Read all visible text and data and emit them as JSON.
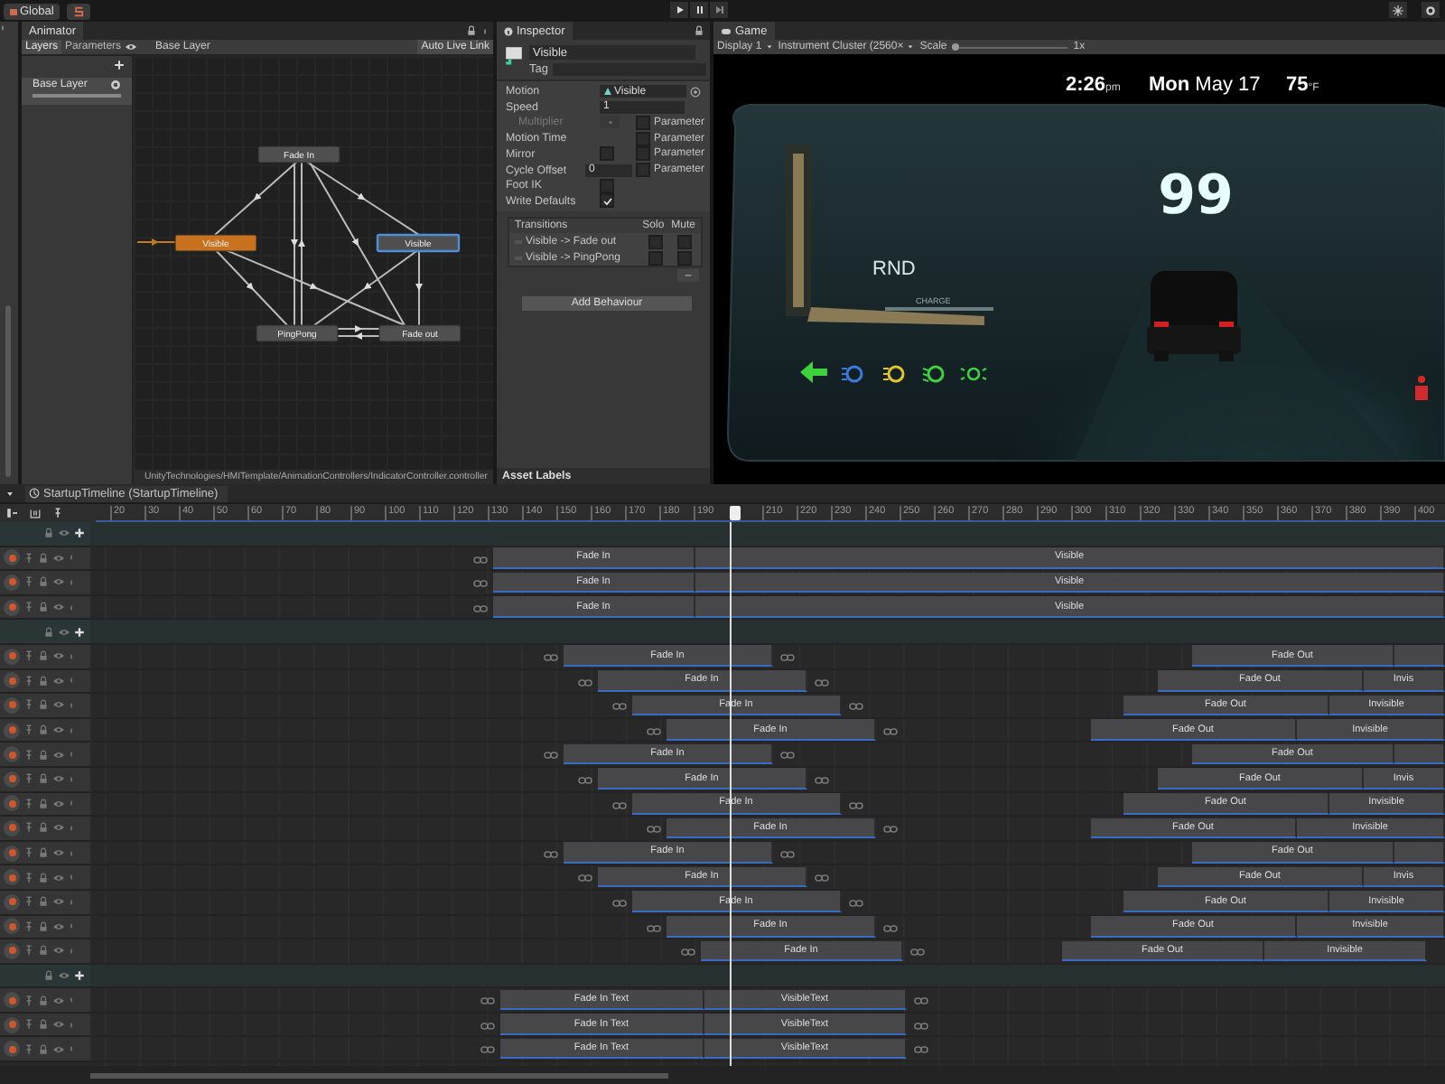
{
  "toolbar": {
    "global_button": "Global"
  },
  "animator": {
    "tab": "Animator",
    "tabs": [
      {
        "label": "Layers",
        "selected": true
      },
      {
        "label": "Parameters",
        "selected": false
      }
    ],
    "breadcrumb": "Base Layer",
    "live_link_button": "Auto Live Link",
    "layers": [
      {
        "name": "Base Layer"
      }
    ],
    "states": [
      {
        "name": "Fade In",
        "kind": "normal",
        "selected": false
      },
      {
        "name": "Visible",
        "kind": "default",
        "selected": false
      },
      {
        "name": "Visible",
        "kind": "normal",
        "selected": true
      },
      {
        "name": "PingPong",
        "kind": "normal",
        "selected": false
      },
      {
        "name": "Fade out",
        "kind": "normal",
        "selected": false
      }
    ],
    "path": "UnityTechnologies/HMITemplate/AnimationControllers/IndicatorController.controller"
  },
  "inspector": {
    "tab": "Inspector",
    "name": "Visible",
    "tag_label": "Tag",
    "properties": [
      {
        "label": "Motion",
        "kind": "object",
        "value": "Visible",
        "disabled": false
      },
      {
        "label": "Speed",
        "kind": "text",
        "value": "1",
        "disabled": false
      },
      {
        "label": "Multiplier",
        "kind": "dropdown",
        "disabled": true,
        "parameter": {
          "label": "Parameter",
          "checked": false
        }
      },
      {
        "label": "Motion Time",
        "kind": "none",
        "disabled": false,
        "parameter": {
          "label": "Parameter",
          "checked": false
        }
      },
      {
        "label": "Mirror",
        "kind": "toggle",
        "checked": false,
        "disabled": false,
        "parameter": {
          "label": "Parameter",
          "checked": false
        }
      },
      {
        "label": "Cycle Offset",
        "kind": "text",
        "value": "0",
        "disabled": false,
        "parameter": {
          "label": "Parameter",
          "checked": false
        }
      },
      {
        "label": "Foot IK",
        "kind": "toggle",
        "checked": false,
        "disabled": false
      },
      {
        "label": "Write Defaults",
        "kind": "toggle",
        "checked": true,
        "disabled": false
      }
    ],
    "transitions": {
      "header": "Transitions",
      "solo_label": "Solo",
      "mute_label": "Mute",
      "items": [
        {
          "name": "Visible -> Fade out",
          "solo": false,
          "mute": false
        },
        {
          "name": "Visible -> PingPong",
          "solo": false,
          "mute": false
        }
      ]
    },
    "remove_button": "–",
    "add_behaviour_button": "Add Behaviour",
    "asset_labels": "Asset Labels"
  },
  "game": {
    "tab": "Game",
    "display": "Display 1",
    "resolution": "Instrument Cluster (2560×",
    "scale_label": "Scale",
    "scale": {
      "level": 0
    },
    "scale_value": "1x",
    "cluster": {
      "time": "2:26",
      "time_suffix": "pm",
      "day": "Mon",
      "date": "May 17",
      "temperature": "75",
      "temperature_unit": "°F",
      "speed": "99",
      "gear": "RND",
      "charge_label": "CHARGE"
    }
  },
  "timeline": {
    "title": "StartupTimeline (StartupTimeline)",
    "ticks": [
      "20",
      "30",
      "40",
      "50",
      "60",
      "70",
      "80",
      "90",
      "100",
      "110",
      "120",
      "130",
      "140",
      "150",
      "160",
      "170",
      "180",
      "190",
      "210",
      "220",
      "230",
      "240",
      "250",
      "260",
      "270",
      "280",
      "290",
      "300",
      "310",
      "320",
      "330",
      "340",
      "350",
      "360",
      "370",
      "380",
      "390",
      "400"
    ],
    "groups": [
      {
        "tracks": [
          {
            "clips": [
              {
                "label": "Fade In"
              },
              {
                "label": "Visible"
              }
            ]
          },
          {
            "clips": [
              {
                "label": "Fade In"
              },
              {
                "label": "Visible"
              }
            ]
          },
          {
            "clips": [
              {
                "label": "Fade In"
              },
              {
                "label": "Visible"
              }
            ]
          }
        ]
      },
      {
        "tracks": [
          {
            "clips": [
              {
                "kind": "labeled",
                "label": "Fade In"
              },
              {
                "kind": "labeled",
                "label": "Fade Out"
              },
              {
                "kind": "blank"
              }
            ]
          },
          {
            "clips": [
              {
                "label": "Fade In"
              },
              {
                "label": "Fade Out"
              },
              {
                "label": "Invis"
              }
            ]
          },
          {
            "clips": [
              {
                "label": "Fade In"
              },
              {
                "label": "Fade Out"
              },
              {
                "label": "Invisible"
              }
            ]
          },
          {
            "clips": [
              {
                "label": "Fade In"
              },
              {
                "label": "Fade Out"
              },
              {
                "label": "Invisible"
              }
            ]
          },
          {
            "clips": [
              {
                "kind": "labeled",
                "label": "Fade In"
              },
              {
                "kind": "labeled",
                "label": "Fade Out"
              },
              {
                "kind": "blank"
              }
            ]
          },
          {
            "clips": [
              {
                "label": "Fade In"
              },
              {
                "label": "Fade Out"
              },
              {
                "label": "Invis"
              }
            ]
          },
          {
            "clips": [
              {
                "label": "Fade In"
              },
              {
                "label": "Fade Out"
              },
              {
                "label": "Invisible"
              }
            ]
          },
          {
            "clips": [
              {
                "label": "Fade In"
              },
              {
                "label": "Fade Out"
              },
              {
                "label": "Invisible"
              }
            ]
          },
          {
            "clips": [
              {
                "kind": "labeled",
                "label": "Fade In"
              },
              {
                "kind": "labeled",
                "label": "Fade Out"
              },
              {
                "kind": "blank"
              }
            ]
          },
          {
            "clips": [
              {
                "label": "Fade In"
              },
              {
                "label": "Fade Out"
              },
              {
                "label": "Invis"
              }
            ]
          },
          {
            "clips": [
              {
                "label": "Fade In"
              },
              {
                "label": "Fade Out"
              },
              {
                "label": "Invisible"
              }
            ]
          },
          {
            "clips": [
              {
                "label": "Fade In"
              },
              {
                "label": "Fade Out"
              },
              {
                "label": "Invisible"
              }
            ]
          },
          {
            "clips": [
              {
                "label": "Fade In"
              },
              {
                "label": "Fade Out"
              },
              {
                "label": "Invisible"
              }
            ]
          }
        ]
      },
      {
        "tracks": [
          {
            "clips": [
              {
                "label": "Fade In Text"
              },
              {
                "label": "VisibleText"
              }
            ]
          },
          {
            "clips": [
              {
                "label": "Fade In Text"
              },
              {
                "label": "VisibleText"
              }
            ]
          },
          {
            "clips": [
              {
                "label": "Fade In Text"
              },
              {
                "label": "VisibleText"
              }
            ]
          }
        ]
      }
    ]
  }
}
